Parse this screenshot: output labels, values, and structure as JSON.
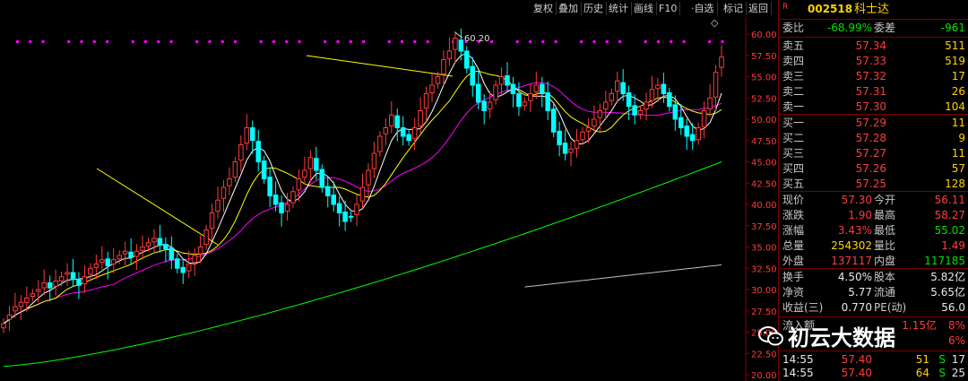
{
  "toolbar": {
    "items": [
      "复权",
      "叠加",
      "历史",
      "统计",
      "画线",
      "F10",
      "·自选",
      "标记",
      "返回"
    ],
    "settings_glyph": "◇"
  },
  "stock": {
    "badge": "R",
    "code": "002518",
    "name": "科士达"
  },
  "order_ratio": {
    "label": "委比",
    "value": "-68.99%",
    "diff_label": "委差",
    "diff_value": "-961"
  },
  "asks": [
    {
      "label": "卖五",
      "price": "57.34",
      "vol": "511"
    },
    {
      "label": "卖四",
      "price": "57.33",
      "vol": "519"
    },
    {
      "label": "卖三",
      "price": "57.32",
      "vol": "17"
    },
    {
      "label": "卖二",
      "price": "57.31",
      "vol": "26"
    },
    {
      "label": "卖一",
      "price": "57.30",
      "vol": "104"
    }
  ],
  "bids": [
    {
      "label": "买一",
      "price": "57.29",
      "vol": "11"
    },
    {
      "label": "买二",
      "price": "57.28",
      "vol": "9"
    },
    {
      "label": "买三",
      "price": "57.27",
      "vol": "11"
    },
    {
      "label": "买四",
      "price": "57.26",
      "vol": "57"
    },
    {
      "label": "买五",
      "price": "57.25",
      "vol": "128"
    }
  ],
  "quote": [
    {
      "l1": "现价",
      "v1": "57.30",
      "c1": "red",
      "l2": "今开",
      "v2": "56.11",
      "c2": "red"
    },
    {
      "l1": "涨跌",
      "v1": "1.90",
      "c1": "red",
      "l2": "最高",
      "v2": "58.27",
      "c2": "red"
    },
    {
      "l1": "涨幅",
      "v1": "3.43%",
      "c1": "red",
      "l2": "最低",
      "v2": "55.02",
      "c2": "grn"
    },
    {
      "l1": "总量",
      "v1": "254302",
      "c1": "yel",
      "l2": "量比",
      "v2": "1.49",
      "c2": "red"
    },
    {
      "l1": "外盘",
      "v1": "137117",
      "c1": "red",
      "l2": "内盘",
      "v2": "117185",
      "c2": "grn"
    }
  ],
  "fundamentals": [
    {
      "l1": "换手",
      "v1": "4.50%",
      "l2": "股本",
      "v2": "5.82亿"
    },
    {
      "l1": "净资",
      "v1": "5.77",
      "l2": "流通",
      "v2": "5.65亿"
    },
    {
      "l1": "收益(三)",
      "v1": "0.770",
      "l2": "PE(动)",
      "v2": "56.0"
    }
  ],
  "partial": [
    {
      "label": "流入额",
      "value": "1.15亿",
      "pct": "8%"
    },
    {
      "label": "",
      "value": "",
      "pct": "6%"
    }
  ],
  "ticks": [
    {
      "time": "14:55",
      "price": "57.40",
      "vol": "51",
      "side": "S",
      "num": "17"
    },
    {
      "time": "14:55",
      "price": "57.40",
      "vol": "64",
      "side": "S",
      "num": "25"
    }
  ],
  "watermark": "初云大数据",
  "colors": {
    "up": "#ff3b3b",
    "down": "#00ffff",
    "ma5": "#ffffff",
    "ma10": "#ffff00",
    "ma20": "#ff00ff",
    "ma60": "#00ff00",
    "ma120": "#c0c0c0",
    "axis": "#8b0000"
  },
  "chart_data": {
    "type": "candlestick",
    "title": "",
    "xlabel": "",
    "ylabel": "",
    "ylim": [
      20.0,
      60.0
    ],
    "y_ticks": [
      "60.00",
      "57.50",
      "55.00",
      "52.50",
      "50.00",
      "47.50",
      "45.00",
      "42.50",
      "40.00",
      "37.50",
      "35.00",
      "32.50",
      "30.00",
      "27.50",
      "25.00",
      "22.50",
      "20.00"
    ],
    "peak_annotation": "60.20",
    "grid": false,
    "close": [
      26,
      27,
      28,
      28.5,
      29,
      29.5,
      30,
      30.8,
      30.2,
      31,
      31.5,
      32,
      31.2,
      30.5,
      31.5,
      32.5,
      33,
      33.5,
      32.8,
      33.5,
      34,
      34.5,
      33.8,
      34.5,
      35,
      35.5,
      36,
      35.2,
      34.8,
      33.5,
      32.5,
      32,
      33,
      34,
      35,
      37,
      39,
      40.5,
      42,
      43,
      45,
      47,
      49,
      47.5,
      45,
      43,
      41,
      40,
      39,
      40,
      41.5,
      43,
      44,
      45.5,
      44,
      42,
      41,
      40,
      39,
      38,
      38.5,
      40,
      42,
      44,
      46,
      48,
      49,
      50.5,
      49,
      48,
      47.5,
      49,
      51,
      53,
      54,
      55,
      57,
      58,
      59.5,
      58,
      56,
      54,
      52,
      51,
      52,
      54,
      55,
      54,
      53,
      51.5,
      52,
      53,
      54,
      53,
      51,
      48.5,
      47,
      46,
      46.5,
      47.5,
      48.5,
      49,
      50,
      51,
      52,
      53,
      54.5,
      53,
      51.5,
      50.5,
      51,
      52,
      53.5,
      54,
      53,
      51.5,
      50,
      49,
      48,
      47.5,
      49,
      51,
      52.5,
      55.5,
      57.3
    ],
    "open": [
      25.5,
      26.5,
      27.5,
      28,
      28.5,
      29.2,
      29.8,
      30.2,
      30.8,
      30.4,
      31,
      31.8,
      32,
      31.2,
      30.7,
      31.8,
      32.6,
      33.2,
      33.6,
      33,
      33.6,
      34.2,
      34.4,
      33.9,
      34.6,
      35.1,
      35.6,
      36,
      35.3,
      34.9,
      33.6,
      32.6,
      32.2,
      33.2,
      34.2,
      35.3,
      37.2,
      39.2,
      40.7,
      42.2,
      43.2,
      45.2,
      47.2,
      49,
      47.4,
      45.1,
      43.2,
      41.1,
      40.2,
      39.2,
      40.2,
      41.7,
      43.2,
      44.2,
      45.4,
      44.1,
      42.1,
      41.1,
      40.1,
      39.1,
      38.6,
      38.8,
      40.4,
      42.3,
      44.2,
      46.2,
      48.3,
      49.2,
      50.4,
      49,
      48.2,
      47.7,
      49.2,
      51.3,
      53.1,
      54.2,
      55.3,
      57.1,
      58.2,
      59.3,
      58,
      56.2,
      54.1,
      52.1,
      51.2,
      52.3,
      54.1,
      55.1,
      54.1,
      53,
      51.6,
      52.2,
      53.2,
      54.1,
      53.1,
      51.2,
      48.6,
      47.2,
      46.1,
      46.6,
      47.6,
      48.6,
      49.2,
      50.2,
      51.2,
      52.2,
      53.3,
      54.3,
      53.1,
      51.6,
      50.6,
      51.2,
      52.2,
      53.6,
      54.1,
      53.1,
      51.7,
      50.2,
      49.2,
      48.2,
      47.6,
      49.1,
      51.2,
      52.6,
      56.1
    ],
    "ma_series": [
      {
        "name": "MA5"
      },
      {
        "name": "MA10"
      },
      {
        "name": "MA20"
      },
      {
        "name": "MA60"
      },
      {
        "name": "MA120"
      }
    ]
  }
}
